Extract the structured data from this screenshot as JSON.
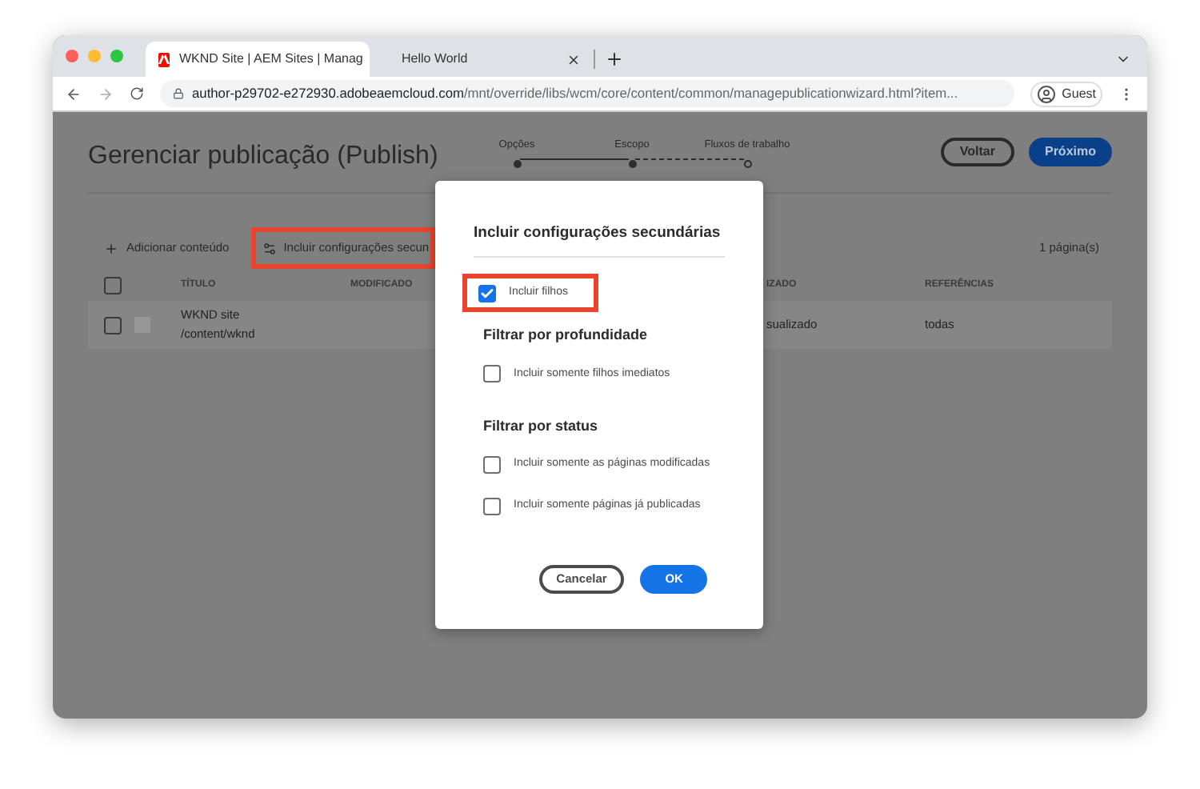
{
  "browser": {
    "tabs": [
      {
        "title": "WKND Site | AEM Sites | Manag",
        "selected": true
      },
      {
        "title": "Hello World",
        "selected": false
      }
    ],
    "url": {
      "host": "author-p29702-e272930.adobeaemcloud.com",
      "path": "/mnt/override/libs/wcm/core/content/common/managepublicationwizard.html?item..."
    },
    "profile": "Guest"
  },
  "page": {
    "title": "Gerenciar publicação (Publish)",
    "steps": [
      {
        "label": "Opções",
        "kind": "done"
      },
      {
        "label": "Escopo",
        "kind": "current"
      },
      {
        "label": "Fluxos de trabalho",
        "kind": "pending"
      }
    ],
    "back_button": "Voltar",
    "next_button": "Próximo"
  },
  "toolbar": {
    "add_content": "Adicionar conteúdo",
    "child_settings": {
      "label": "Incluir configurações secun",
      "highlighted": true
    },
    "page_count": "1 página(s)"
  },
  "table": {
    "select_all_checked": false,
    "columns": [
      "TÍTULO",
      "MODIFICADO",
      "IZADO",
      "REFERÊNCIAS"
    ],
    "rows": [
      {
        "title": "WKND site",
        "path": "/content/wknd",
        "column_3": "sualizado",
        "references": "todas",
        "checked": false
      }
    ]
  },
  "dialog": {
    "title": "Incluir configurações secundárias",
    "sections": [
      {
        "options": [
          {
            "label": "Incluir filhos",
            "checked": true,
            "highlighted": true
          }
        ]
      },
      {
        "heading": "Filtrar por profundidade",
        "options": [
          {
            "label": "Incluir somente filhos imediatos",
            "checked": false,
            "highlighted": false
          }
        ]
      },
      {
        "heading": "Filtrar por status",
        "options": [
          {
            "label": "Incluir somente as páginas modificadas",
            "checked": false,
            "highlighted": false
          },
          {
            "label": "Incluir somente páginas já publicadas",
            "checked": false,
            "highlighted": false
          }
        ]
      }
    ],
    "cancel_button": "Cancelar",
    "ok_button": "OK"
  }
}
